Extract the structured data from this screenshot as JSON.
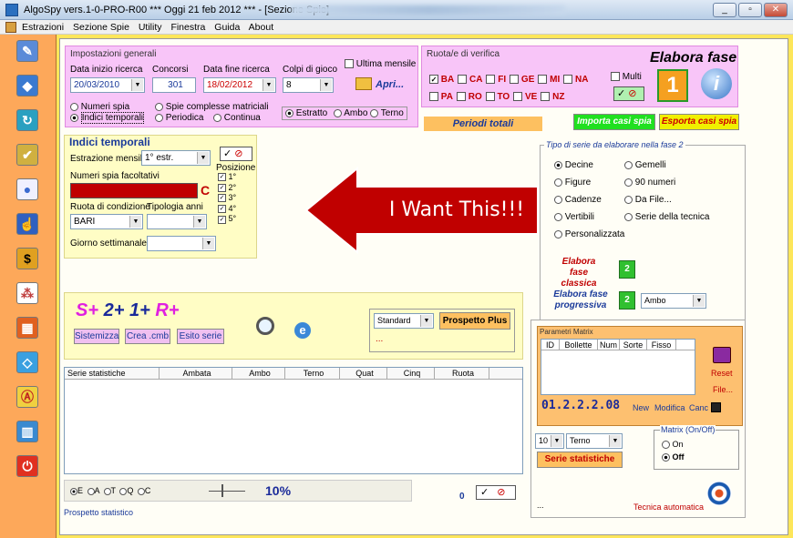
{
  "window": {
    "title": "AlgoSpy vers.1-0-PRO-R00  ***  Oggi 21 feb 2012  ***  - [Sezione Spie]"
  },
  "menu": [
    "Estrazioni",
    "Sezione Spie",
    "Utility",
    "Finestra",
    "Guida",
    "About"
  ],
  "impostazioni": {
    "title": "Impostazioni generali",
    "data_inizio_label": "Data inizio ricerca",
    "data_inizio": "20/03/2010",
    "concorsi_label": "Concorsi",
    "concorsi": "301",
    "data_fine_label": "Data fine ricerca",
    "data_fine": "18/02/2012",
    "colpi_label": "Colpi di gioco",
    "colpi": "8",
    "ultima_mensile": "Ultima mensile",
    "apri": "Apri...",
    "numeri_spia": "Numeri spia",
    "indici_temporali": "Indici temporali",
    "spie_complesse": "Spie complesse matriciali",
    "periodica": "Periodica",
    "continua": "Continua",
    "estratto": "Estratto",
    "ambo": "Ambo",
    "terno": "Terno"
  },
  "ruote": {
    "title": "Ruota/e di verifica",
    "row1": [
      "BA",
      "CA",
      "FI",
      "GE",
      "MI",
      "NA"
    ],
    "row2": [
      "PA",
      "RO",
      "TO",
      "VE",
      "NZ"
    ],
    "multi": "Multi",
    "elabora_fase": "Elabora fase",
    "fase_num": "1",
    "periodi_totali": "Periodi totali",
    "importa": "Importa casi spia",
    "esporta": "Esporta casi spia"
  },
  "indici": {
    "title": "Indici temporali",
    "estrazione_label": "Estrazione mensile:",
    "estrazione_value": "1° estr.",
    "numeri_label": "Numeri spia facoltativi",
    "c_letter": "C",
    "posizione": "Posizione",
    "pos": [
      "1°",
      "2°",
      "3°",
      "4°",
      "5°"
    ],
    "ruota_label": "Ruota di condizione",
    "ruota_value": "BARI",
    "tipologia_label": "Tipologia anni",
    "giorno_label": "Giorno settimanale"
  },
  "annotation": {
    "text": "I Want This!!!"
  },
  "serie": {
    "title": "Tipo di serie da elaborare nella fase 2",
    "options": [
      "Decine",
      "Gemelli",
      "Figure",
      "90 numeri",
      "Cadenze",
      "Da File...",
      "Vertibili",
      "Serie della tecnica",
      "Personalizzata"
    ],
    "classica": "Elabora fase classica",
    "progressiva": "Elabora fase progressiva",
    "fase2": "2",
    "ambo": "Ambo"
  },
  "sistema": {
    "s": "S+",
    "n2": "2+",
    "n1": "1+",
    "r": "R+",
    "sistemizza": "Sistemizza",
    "crea": "Crea .cmb",
    "esito": "Esito serie",
    "standard": "Standard",
    "prospetto_plus": "Prospetto Plus",
    "dots": "..."
  },
  "matrix": {
    "title": "Parametri Matrix",
    "cols": [
      "ID",
      "Bollette",
      "Num",
      "Sorte",
      "Fisso"
    ],
    "reset": "Reset",
    "file": "File...",
    "code": "01.2.2.2.08",
    "new": "New",
    "modifica": "Modifica",
    "canc": "Canc",
    "num": "10",
    "terno": "Terno",
    "serie_stat": "Serie statistiche",
    "onoff_title": "Matrix (On/Off)",
    "on": "On",
    "off": "Off",
    "tecnica": "Tecnica automatica",
    "dots": "..."
  },
  "table": {
    "cols": [
      "Serie statistiche",
      "Ambata",
      "Ambo",
      "Terno",
      "Quat",
      "Cinq",
      "Ruota"
    ]
  },
  "bottom": {
    "letters": [
      "E",
      "A",
      "T",
      "Q",
      "C"
    ],
    "pct": "10%",
    "zero": "0",
    "prospetto": "Prospetto statistico"
  },
  "colors": {
    "pink": "#f8c5f8",
    "yellow": "#fffdc5",
    "orange": "#fda85a",
    "red": "#c00000",
    "arrow": "#c00000"
  }
}
